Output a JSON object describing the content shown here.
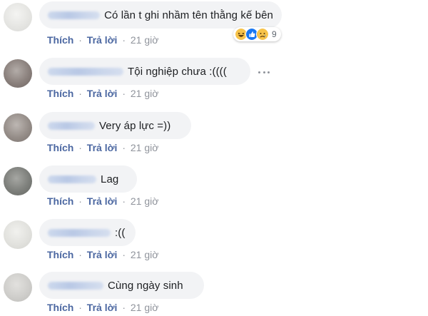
{
  "actions": {
    "like_label": "Thích",
    "reply_label": "Trả lời",
    "separator": "·",
    "time_label": "21 giờ"
  },
  "comments": [
    {
      "text": "Có lần t ghi nhầm tên thằng kế bên",
      "reactions": {
        "icons": [
          "haha-icon",
          "like-icon",
          "sad-icon"
        ],
        "count": "9"
      }
    },
    {
      "text": "Tội nghiệp chưa :(((("
    },
    {
      "text": "Very áp lực =))"
    },
    {
      "text": "Lag"
    },
    {
      "text": ":(("
    },
    {
      "text": "Cùng ngày sinh"
    }
  ],
  "colors": {
    "link_blue": "#4b67a1",
    "meta_gray": "#90949c",
    "bubble_bg": "#f2f3f5",
    "text_dark": "#1c1e21",
    "like_blue": "#1877f2",
    "emoji_yellow": "#f7c34a"
  }
}
